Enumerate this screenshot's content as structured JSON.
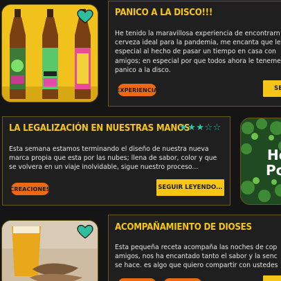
{
  "posts": [
    {
      "title": "PANICO A LA DISCO!!!",
      "excerpt": [
        "He tenido la maravillosa experiencia de encontrarn",
        "cerveza ideal para la pandemia, me encanta que le",
        "especial al hecho de pasar un tiempo en casa con",
        "amigos; en especial por que todos ahora le teneme",
        "panico a la disco."
      ],
      "tag": "EXPERIENCIA",
      "button": "SE",
      "favorite_icon": "heart-icon"
    },
    {
      "title": "LA LEGALIZACIÓN EN NUESTRAS MANOS",
      "rating": 3,
      "rating_max": 5,
      "stars_filled": "★★★",
      "stars_empty": "☆☆",
      "excerpt": [
        "Esta semana estamos terminando el diseño de nuestra nueva",
        "marca propia que esta por las nubes; llena de sabor, color y que",
        "se volvera en un viaje inolvidable, sigue nuestro proceso..."
      ],
      "tag": "CREACIONES",
      "button": "SEGUIR LEYENDO...",
      "image_text": [
        "Ho",
        "Po"
      ]
    },
    {
      "title": "ACOMPAÑAMIENTO DE DIOSES",
      "excerpt": [
        "Esta pequeña receta acompaña las noches de cop",
        "amigos, nos ha encantado tanto el sabor y la senc",
        "se hace. es algo que quiero compartir con ustedes"
      ],
      "favorite_icon": "heart-icon"
    }
  ],
  "colors": {
    "accent": "#f5c518",
    "tag": "#ee6a12",
    "teal": "#32c4a8",
    "background": "#151515"
  }
}
